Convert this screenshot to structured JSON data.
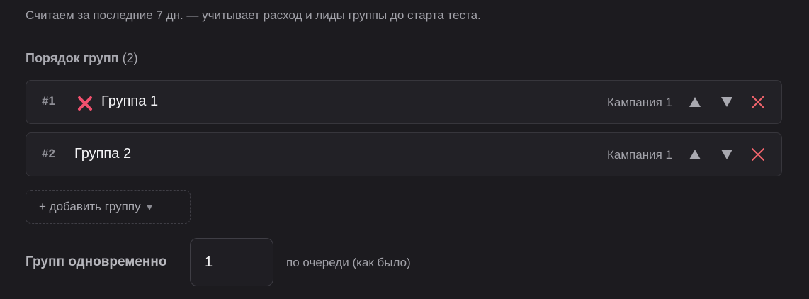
{
  "hint_text": "Считаем за последние 7 дн. — учитывает расход и лиды группы до старта теста.",
  "group_order": {
    "title": "Порядок групп",
    "count": "(2)",
    "rows": [
      {
        "index": "#1",
        "status_icon": "red-x-icon",
        "name": "Группа 1",
        "campaign": "Кампания 1"
      },
      {
        "index": "#2",
        "name": "Группа 2",
        "campaign": "Кампания 1"
      }
    ]
  },
  "controls": {
    "up_icon": "triangle-up-icon",
    "down_icon": "triangle-down-icon",
    "remove_icon": "close-icon"
  },
  "add_group": {
    "label": "+ добавить группу",
    "caret": "▼"
  },
  "concurrent": {
    "label": "Групп одновременно",
    "value": "1",
    "hint": "по очереди (как было)"
  },
  "colors": {
    "background": "#1c1b1f",
    "row_background": "#222126",
    "remove_accent": "#f0646c",
    "status_error": "#f0506e"
  }
}
